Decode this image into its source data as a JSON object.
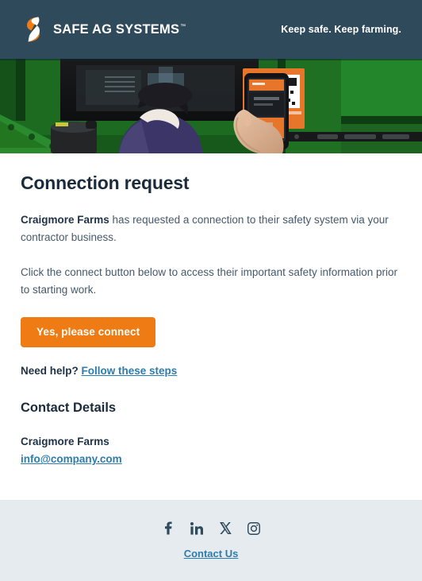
{
  "header": {
    "brand_name": "SAFE AG SYSTEMS",
    "brand_tm": "™",
    "logo_icon": "safe-ag-systems-s-mark",
    "tagline": "Keep safe. Keep farming."
  },
  "hero": {
    "alt": "Worker scanning an orange QR code sign on green farm machinery with a mobile phone"
  },
  "main": {
    "title": "Connection request",
    "paragraph1_strong": "Craigmore Farms",
    "paragraph1_rest": " has requested a connection to their safety system via your contractor business.",
    "paragraph2": "Click the connect button below to access their important safety information prior to starting work.",
    "cta_label": "Yes, please connect",
    "help_prefix": "Need help? ",
    "help_link": "Follow these steps",
    "contact_heading": "Contact Details",
    "contact_name": "Craigmore Farms",
    "contact_email": "info@company.com"
  },
  "footer": {
    "social": [
      {
        "name": "facebook-icon",
        "label": "Facebook"
      },
      {
        "name": "linkedin-icon",
        "label": "LinkedIn"
      },
      {
        "name": "x-twitter-icon",
        "label": "X"
      },
      {
        "name": "instagram-icon",
        "label": "Instagram"
      }
    ],
    "contact_link": "Contact Us"
  },
  "colors": {
    "header_bg": "#2f4a5b",
    "footer_bg": "#e6ebf0",
    "accent_orange": "#ee7b13",
    "link_blue": "#2d7cad",
    "heading": "#1b2b3b",
    "body_text": "#45596b"
  }
}
